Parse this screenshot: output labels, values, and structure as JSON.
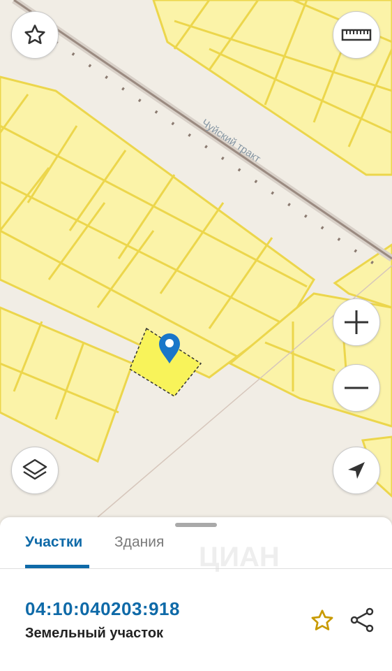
{
  "map": {
    "road_label": "Чуйский тракт",
    "colors": {
      "background": "#f1ede5",
      "parcel_fill": "#fbf3a8",
      "parcel_stroke": "#ecd64c",
      "selected_fill": "#f8f35a",
      "road": "#9a8a80",
      "pin": "#1976c9"
    }
  },
  "controls": {
    "favorite": "star-icon",
    "ruler": "ruler-icon",
    "zoom_in": "plus-icon",
    "zoom_out": "minus-icon",
    "layers": "layers-icon",
    "locate": "navigation-arrow-icon"
  },
  "sheet": {
    "tabs": [
      {
        "label": "Участки",
        "active": true
      },
      {
        "label": "Здания",
        "active": false
      }
    ],
    "watermark": "ЦИАН",
    "parcel": {
      "cadastral_number": "04:10:040203:918",
      "type": "Земельный участок"
    }
  }
}
